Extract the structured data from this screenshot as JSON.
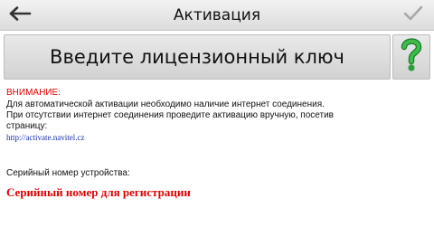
{
  "header": {
    "title": "Активация",
    "back_icon": "arrow-left-icon",
    "confirm_icon": "checkmark-icon"
  },
  "license_button": {
    "label": "Введите лицензионный ключ",
    "help_icon": "question-mark-icon",
    "help_color": "#2e9d3a"
  },
  "notice": {
    "warning_title": "ВНИМАНИЕ:",
    "line1": "Для автоматической активации необходимо наличие интернет соединения.",
    "line2": "При отсутствии интернет соединения проведите активацию вручную, посетив",
    "line3": "страницу:",
    "link": "http://activate.navitel.cz"
  },
  "serial": {
    "caption": "Серийный номер устройства:",
    "value": "Серийный номер для регистрации"
  },
  "colors": {
    "warning": "#e00000",
    "link": "#1a2fb0"
  }
}
